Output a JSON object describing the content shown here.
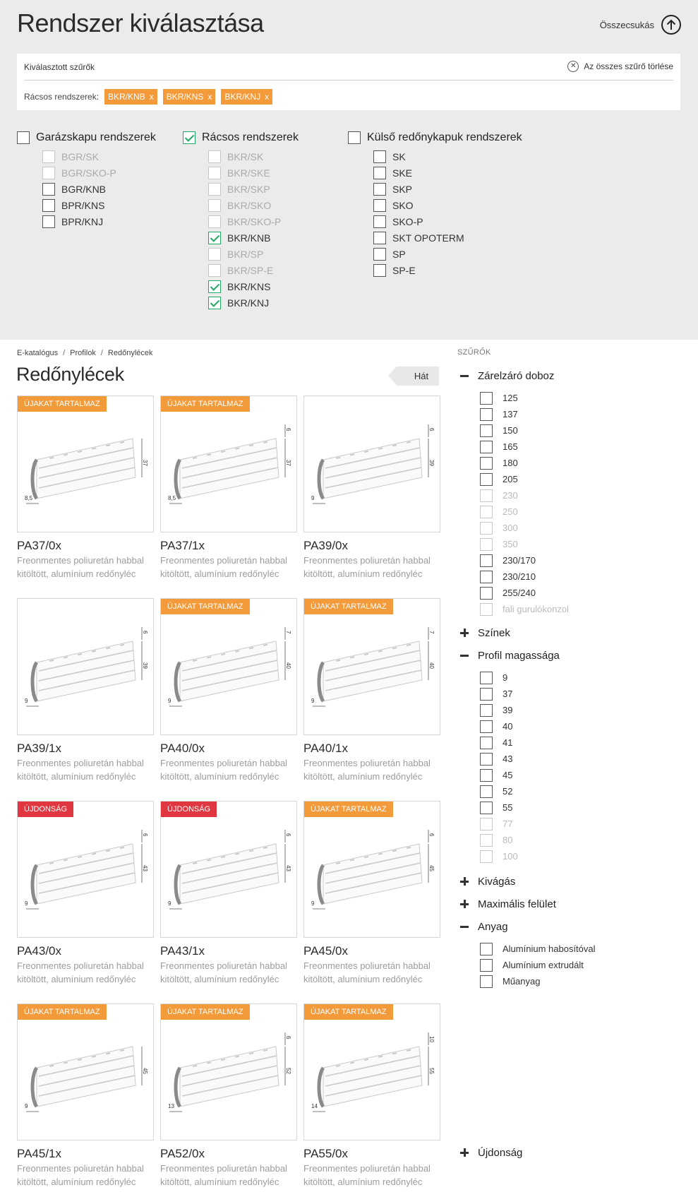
{
  "top": {
    "title": "Rendszer kiválasztása",
    "collapse_label": "Összecsukás",
    "selected_filters_label": "Kiválasztott szűrők",
    "clear_all_label": "Az összes szűrő törlése",
    "chips_prefix": "Rácsos rendszerek:",
    "chips": [
      "BKR/KNB",
      "BKR/KNS",
      "BKR/KNJ"
    ],
    "chip_remove": "x"
  },
  "systems": [
    {
      "label": "Garázskapu rendszerek",
      "checked": false,
      "items": [
        {
          "label": "BGR/SK",
          "state": "disabled"
        },
        {
          "label": "BGR/SKO-P",
          "state": "disabled"
        },
        {
          "label": "BGR/KNB",
          "state": "enabled"
        },
        {
          "label": "BPR/KNS",
          "state": "enabled"
        },
        {
          "label": "BPR/KNJ",
          "state": "enabled"
        }
      ]
    },
    {
      "label": "Rácsos rendszerek",
      "checked": true,
      "items": [
        {
          "label": "BKR/SK",
          "state": "disabled"
        },
        {
          "label": "BKR/SKE",
          "state": "disabled"
        },
        {
          "label": "BKR/SKP",
          "state": "disabled"
        },
        {
          "label": "BKR/SKO",
          "state": "disabled"
        },
        {
          "label": "BKR/SKO-P",
          "state": "disabled"
        },
        {
          "label": "BKR/KNB",
          "state": "checked"
        },
        {
          "label": "BKR/SP",
          "state": "disabled"
        },
        {
          "label": "BKR/SP-E",
          "state": "disabled"
        },
        {
          "label": "BKR/KNS",
          "state": "checked"
        },
        {
          "label": "BKR/KNJ",
          "state": "checked"
        }
      ]
    },
    {
      "label": "Külső redőnykapuk rendszerek",
      "checked": false,
      "items": [
        {
          "label": "SK",
          "state": "enabled"
        },
        {
          "label": "SKE",
          "state": "enabled"
        },
        {
          "label": "SKP",
          "state": "enabled"
        },
        {
          "label": "SKO",
          "state": "enabled"
        },
        {
          "label": "SKO-P",
          "state": "enabled"
        },
        {
          "label": "SKT OPOTERM",
          "state": "enabled"
        },
        {
          "label": "SP",
          "state": "enabled"
        },
        {
          "label": "SP-E",
          "state": "enabled"
        }
      ]
    }
  ],
  "breadcrumb": [
    "E-katalógus",
    "Profilok",
    "Redőnylécek"
  ],
  "breadcrumb_sep": "/",
  "page_title": "Redőnylécek",
  "back_label": "Hát",
  "products": [
    {
      "name": "PA37/0x",
      "desc": "Freonmentes poliuretán habbal kitöltött, alumínium redőnyléc",
      "badge": "ÚJAKAT TARTALMAZ",
      "badge_color": "#f39a3b",
      "height_label": "37",
      "top_label": "",
      "bottom_label": "8,5"
    },
    {
      "name": "PA37/1x",
      "desc": "Freonmentes poliuretán habbal kitöltött, alumínium redőnyléc",
      "badge": "ÚJAKAT TARTALMAZ",
      "badge_color": "#f39a3b",
      "height_label": "37",
      "top_label": "6",
      "bottom_label": "8,5"
    },
    {
      "name": "PA39/0x",
      "desc": "Freonmentes poliuretán habbal kitöltött, alumínium redőnyléc",
      "badge": "",
      "badge_color": "",
      "height_label": "39",
      "top_label": "6",
      "bottom_label": "9"
    },
    {
      "name": "PA39/1x",
      "desc": "Freonmentes poliuretán habbal kitöltött, alumínium redőnyléc",
      "badge": "",
      "badge_color": "",
      "height_label": "39",
      "top_label": "6",
      "bottom_label": "9"
    },
    {
      "name": "PA40/0x",
      "desc": "Freonmentes poliuretán habbal kitöltött, alumínium redőnyléc",
      "badge": "ÚJAKAT TARTALMAZ",
      "badge_color": "#f39a3b",
      "height_label": "40",
      "top_label": "7",
      "bottom_label": "9"
    },
    {
      "name": "PA40/1x",
      "desc": "Freonmentes poliuretán habbal kitöltött, alumínium redőnyléc",
      "badge": "ÚJAKAT TARTALMAZ",
      "badge_color": "#f39a3b",
      "height_label": "40",
      "top_label": "7",
      "bottom_label": "9"
    },
    {
      "name": "PA43/0x",
      "desc": "Freonmentes poliuretán habbal kitöltött, alumínium redőnyléc",
      "badge": "ÚJDONSÁG",
      "badge_color": "#e0363f",
      "height_label": "43",
      "top_label": "6",
      "bottom_label": "9"
    },
    {
      "name": "PA43/1x",
      "desc": "Freonmentes poliuretán habbal kitöltött, alumínium redőnyléc",
      "badge": "ÚJDONSÁG",
      "badge_color": "#e0363f",
      "height_label": "43",
      "top_label": "6",
      "bottom_label": "9"
    },
    {
      "name": "PA45/0x",
      "desc": "Freonmentes poliuretán habbal kitöltött, alumínium redőnyléc",
      "badge": "ÚJAKAT TARTALMAZ",
      "badge_color": "#f39a3b",
      "height_label": "45",
      "top_label": "6",
      "bottom_label": "9"
    },
    {
      "name": "PA45/1x",
      "desc": "Freonmentes poliuretán habbal kitöltött, alumínium redőnyléc",
      "badge": "ÚJAKAT TARTALMAZ",
      "badge_color": "#f39a3b",
      "height_label": "45",
      "top_label": "",
      "bottom_label": "9"
    },
    {
      "name": "PA52/0x",
      "desc": "Freonmentes poliuretán habbal kitöltött, alumínium redőnyléc",
      "badge": "ÚJAKAT TARTALMAZ",
      "badge_color": "#f39a3b",
      "height_label": "52",
      "top_label": "6",
      "bottom_label": "13"
    },
    {
      "name": "PA55/0x",
      "desc": "Freonmentes poliuretán habbal kitöltött, alumínium redőnyléc",
      "badge": "ÚJAKAT TARTALMAZ",
      "badge_color": "#f39a3b",
      "height_label": "55",
      "top_label": "10",
      "bottom_label": "14"
    }
  ],
  "sidebar": {
    "title": "SZŰRŐK",
    "groups": [
      {
        "label": "Zárelzáró doboz",
        "expanded": true,
        "items": [
          {
            "label": "125",
            "disabled": false
          },
          {
            "label": "137",
            "disabled": false
          },
          {
            "label": "150",
            "disabled": false
          },
          {
            "label": "165",
            "disabled": false
          },
          {
            "label": "180",
            "disabled": false
          },
          {
            "label": "205",
            "disabled": false
          },
          {
            "label": "230",
            "disabled": true
          },
          {
            "label": "250",
            "disabled": true
          },
          {
            "label": "300",
            "disabled": true
          },
          {
            "label": "350",
            "disabled": true
          },
          {
            "label": "230/170",
            "disabled": false
          },
          {
            "label": "230/210",
            "disabled": false
          },
          {
            "label": "255/240",
            "disabled": false
          },
          {
            "label": "fali gurulókonzol",
            "disabled": true
          }
        ]
      },
      {
        "label": "Színek",
        "expanded": false,
        "items": []
      },
      {
        "label": "Profil magassága",
        "expanded": true,
        "items": [
          {
            "label": "9",
            "disabled": false
          },
          {
            "label": "37",
            "disabled": false
          },
          {
            "label": "39",
            "disabled": false
          },
          {
            "label": "40",
            "disabled": false
          },
          {
            "label": "41",
            "disabled": false
          },
          {
            "label": "43",
            "disabled": false
          },
          {
            "label": "45",
            "disabled": false
          },
          {
            "label": "52",
            "disabled": false
          },
          {
            "label": "55",
            "disabled": false
          },
          {
            "label": "77",
            "disabled": true
          },
          {
            "label": "80",
            "disabled": true
          },
          {
            "label": "100",
            "disabled": true
          }
        ]
      },
      {
        "label": "Kivágás",
        "expanded": false,
        "items": []
      },
      {
        "label": "Maximális felület",
        "expanded": false,
        "items": []
      },
      {
        "label": "Anyag",
        "expanded": true,
        "items": [
          {
            "label": "Alumínium habosítóval",
            "disabled": false
          },
          {
            "label": "Alumínium extrudált",
            "disabled": false
          },
          {
            "label": "Műanyag",
            "disabled": false
          }
        ]
      },
      {
        "label": "Újdonság",
        "expanded": false,
        "items": []
      }
    ]
  }
}
